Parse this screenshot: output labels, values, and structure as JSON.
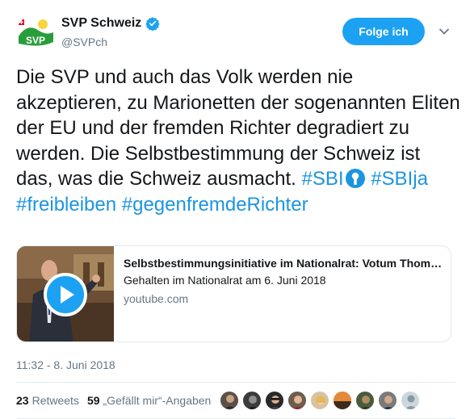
{
  "account": {
    "name": "SVP Schweiz",
    "handle": "@SVPch",
    "verified_icon": "verified-badge-icon",
    "avatar_logo_text": "SVP"
  },
  "follow_button": {
    "label": "Folge ich"
  },
  "menu_icon": "chevron-down-icon",
  "tweet": {
    "text_part1": "Die SVP und auch das Volk werden nie akzeptieren, zu Marionetten der sogenannten Eliten der EU und der fremden Richter degradiert zu werden. Die Selbstbestimmung der Schweiz ist das, was die Schweiz ausmacht. ",
    "hashtag_sbi": "#SBI",
    "hashtag_sblja": "#SBIja",
    "hashtag_freibleiben": "#freibleiben",
    "hashtag_gegenfremderichter": "#gegenfremdeRichter"
  },
  "link_card": {
    "title": "Selbstbestimmungsinitiative im Nationalrat: Votum Thomas...",
    "description": "Gehalten im Nationalrat am 6. Juni 2018",
    "domain": "youtube.com",
    "thumbnail_icon": "play-video-icon"
  },
  "timestamp": "11:32 - 8. Juni 2018",
  "stats": {
    "retweets_count": "23",
    "retweets_label": "Retweets",
    "likes_count": "59",
    "likes_label": "„Gefällt mir“-Angaben"
  },
  "colors": {
    "accent": "#1da1f2",
    "link": "#1b95e0",
    "muted": "#657786",
    "logo_green": "#2a9d3b",
    "logo_yellow": "#f6d63a"
  }
}
